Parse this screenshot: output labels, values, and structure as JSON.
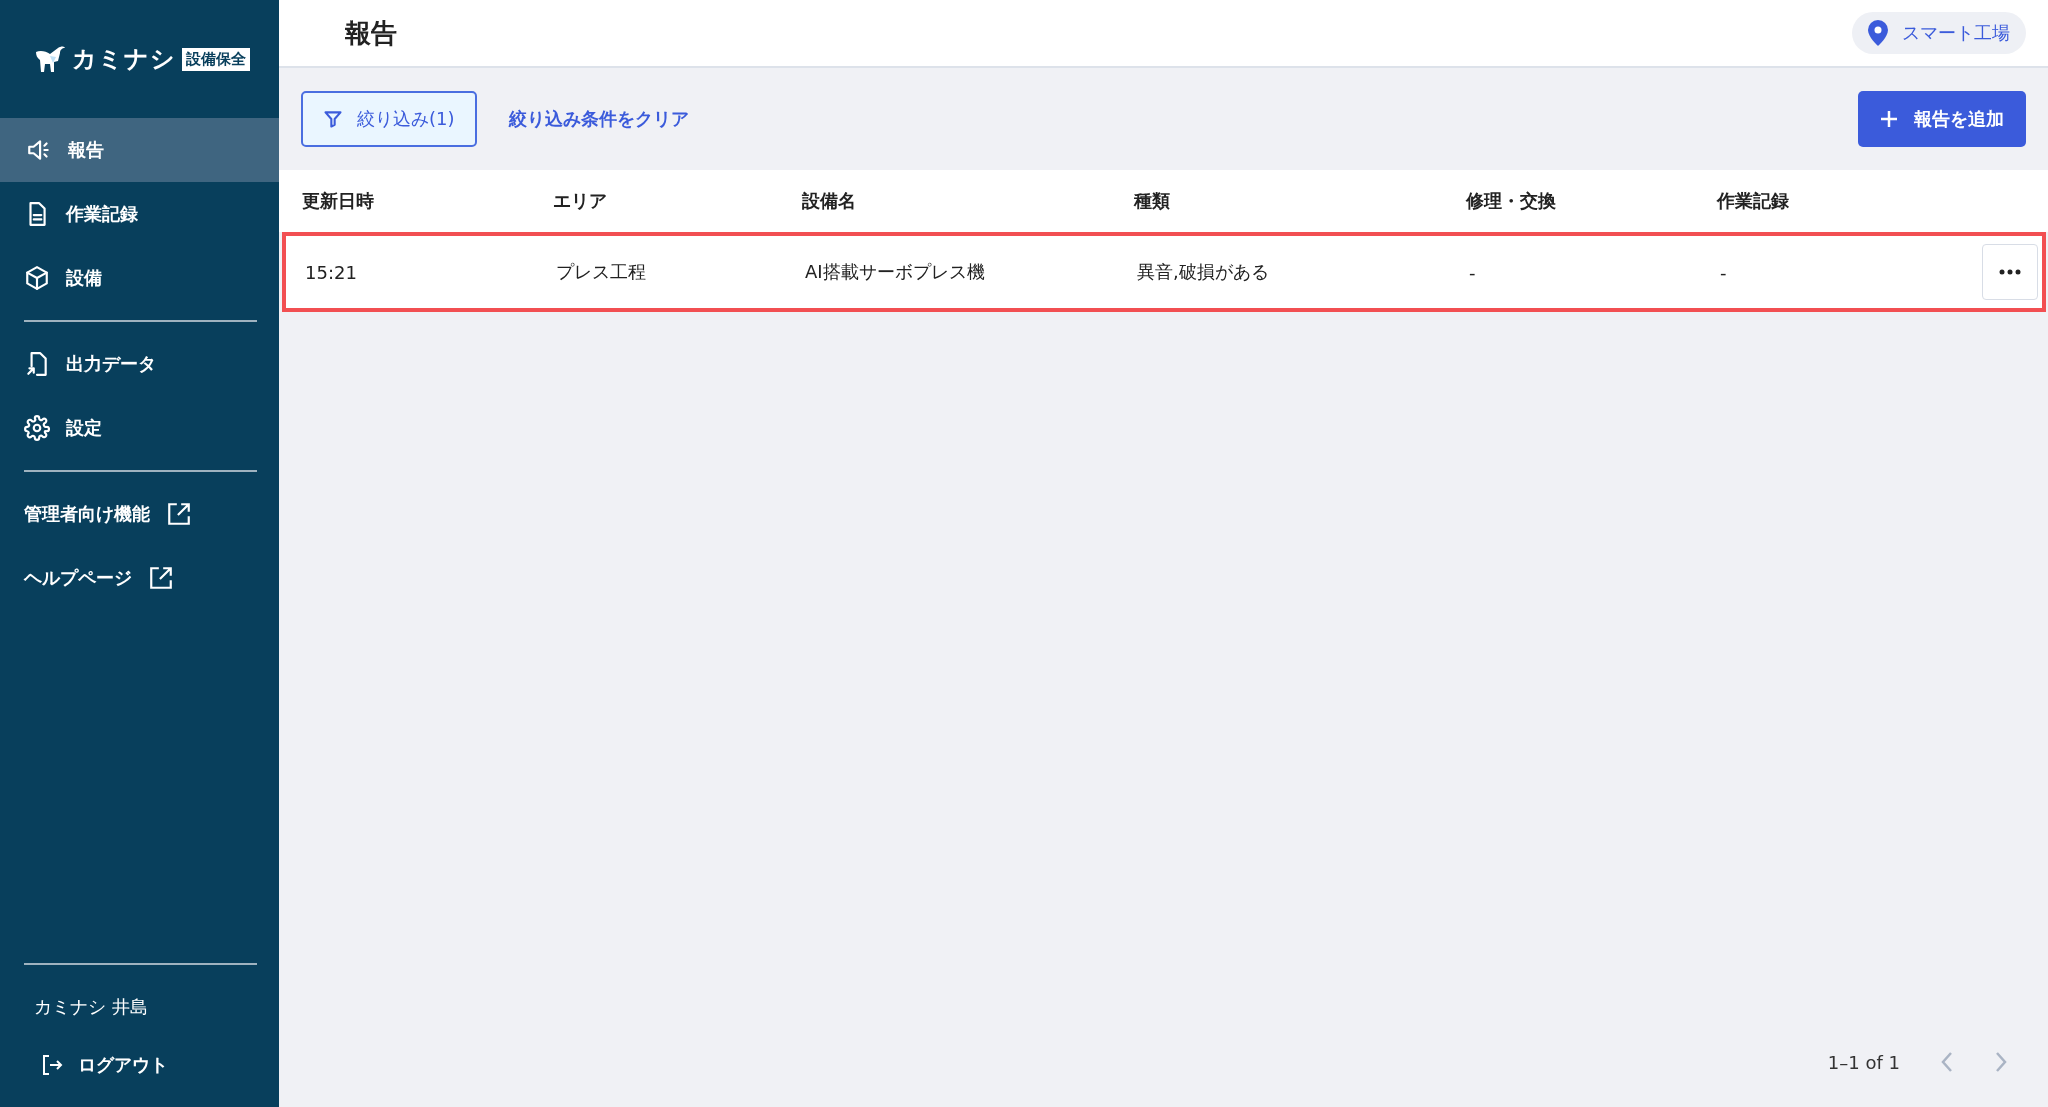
{
  "sidebar": {
    "logo": {
      "name": "カミナシ",
      "badge": "設備保全"
    },
    "groups": [
      [
        {
          "label": "報告",
          "kind": "megaphone",
          "selected": true,
          "external": false
        },
        {
          "label": "作業記録",
          "kind": "document",
          "selected": false,
          "external": false
        },
        {
          "label": "設備",
          "kind": "cube",
          "selected": false,
          "external": false
        }
      ],
      [
        {
          "label": "出力データ",
          "kind": "export",
          "selected": false,
          "external": false
        },
        {
          "label": "設定",
          "kind": "gear",
          "selected": false,
          "external": false
        }
      ],
      [
        {
          "label": "管理者向け機能",
          "kind": "link",
          "selected": false,
          "external": true
        },
        {
          "label": "ヘルプページ",
          "kind": "link",
          "selected": false,
          "external": true
        }
      ]
    ],
    "user": "カミナシ 井島",
    "logout": "ログアウト"
  },
  "header": {
    "title": "報告",
    "location": "スマート工場"
  },
  "toolbar": {
    "filter": "絞り込み(1)",
    "clear": "絞り込み条件をクリア",
    "add": "報告を追加"
  },
  "table": {
    "columns": [
      "更新日時",
      "エリア",
      "設備名",
      "種類",
      "修理・交換",
      "作業記録"
    ],
    "rows": [
      {
        "cells": [
          "15:21",
          "プレス工程",
          "AI搭載サーボプレス機",
          "異音,破損がある",
          "-",
          "-"
        ],
        "selected": true
      }
    ]
  },
  "pagination": {
    "range": "1–1 of 1",
    "prev_disabled": true,
    "next_disabled": true
  }
}
